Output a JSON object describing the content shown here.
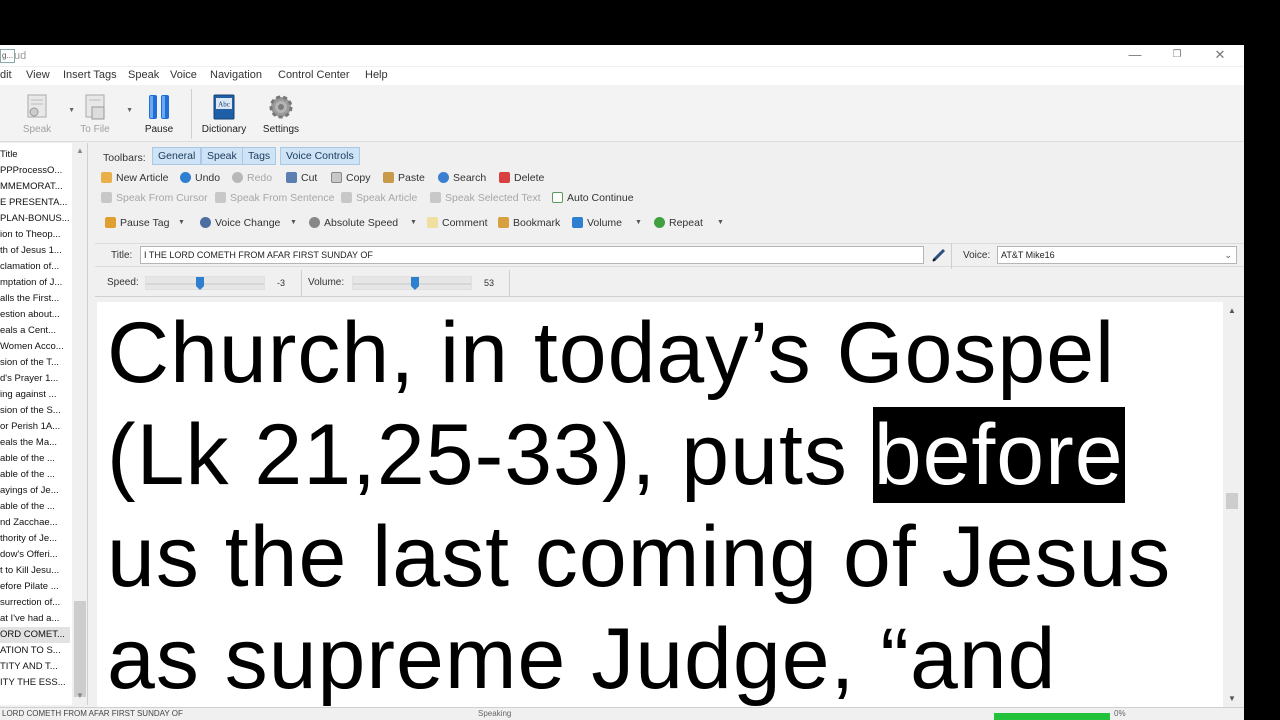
{
  "window": {
    "title": "ud",
    "controls": {
      "minimize": "—",
      "restore": "❐",
      "close": "✕"
    }
  },
  "menubar": {
    "items": [
      "dit",
      "View",
      "Insert Tags",
      "Speak",
      "Voice",
      "Navigation",
      "Control Center",
      "Help"
    ]
  },
  "toolbar": {
    "speak_label": "Speak",
    "tofile_label": "To File",
    "pause_label": "Pause",
    "dictionary_label": "Dictionary",
    "settings_label": "Settings",
    "dictionary_icon_text": "Abc"
  },
  "sidebar": {
    "header": "Title",
    "items": [
      "PPProcessO...",
      "MMEMORAT...",
      "E PRESENTA...",
      "PLAN-BONUS...",
      "ion to Theop...",
      "th of Jesus 1...",
      "clamation of...",
      "mptation of J...",
      "alls the First...",
      "estion about...",
      "eals a Cent...",
      "Women Acco...",
      "sion of the T...",
      "d's Prayer 1...",
      "ing against ...",
      "sion of the S...",
      "or Perish 1A...",
      "eals the Ma...",
      "able of the ...",
      "able of the ...",
      "ayings of Je...",
      "able of the ...",
      "nd Zacchae...",
      "thority of Je...",
      "dow's Offeri...",
      "t to Kill Jesu...",
      "efore Pilate ...",
      "surrection of...",
      "at I've had a...",
      "ORD COMET...",
      "ATION TO S...",
      "TITY AND T...",
      "ITY THE ESS..."
    ],
    "selected_index": 29
  },
  "toolbars": {
    "label": "Toolbars:",
    "tabs": [
      "General",
      "Speak",
      "Tags",
      "Voice Controls"
    ]
  },
  "general_row": {
    "new_article": "New Article",
    "undo": "Undo",
    "redo": "Redo",
    "cut": "Cut",
    "copy": "Copy",
    "paste": "Paste",
    "search": "Search",
    "delete": "Delete"
  },
  "speak_row": {
    "from_cursor": "Speak From Cursor",
    "from_sentence": "Speak From Sentence",
    "article": "Speak Article",
    "selected_text": "Speak Selected Text",
    "auto_continue": "Auto Continue"
  },
  "tags_row": {
    "pause_tag": "Pause Tag",
    "voice_change": "Voice Change",
    "absolute_speed": "Absolute Speed",
    "comment": "Comment",
    "bookmark": "Bookmark",
    "volume": "Volume",
    "repeat": "Repeat"
  },
  "title_field": {
    "label": "Title:",
    "value": "I THE LORD COMETH FROM AFAR FIRST SUNDAY OF"
  },
  "voice_field": {
    "label": "Voice:",
    "value": "AT&T Mike16"
  },
  "speed": {
    "label": "Speed:",
    "value": "-3",
    "position_fraction": 0.45
  },
  "volume": {
    "label": "Volume:",
    "value": "53",
    "position_fraction": 0.53
  },
  "editor": {
    "text_before": "Church, in today’s Gospel (Lk 21,25-33), puts ",
    "highlighted_word": "before",
    "text_after": " us the last coming of Jesus as supreme Judge, “and"
  },
  "statusbar": {
    "text": "LORD COMETH FROM AFAR FIRST SUNDAY OF",
    "middle": "Speaking",
    "progress_fraction": 1.0,
    "percent": "0%"
  },
  "colors": {
    "tab_bg": "#cfe3f7",
    "slider_knob": "#2f7fd0",
    "highlight_bg": "#000000",
    "progress_fill": "#22c33a"
  }
}
